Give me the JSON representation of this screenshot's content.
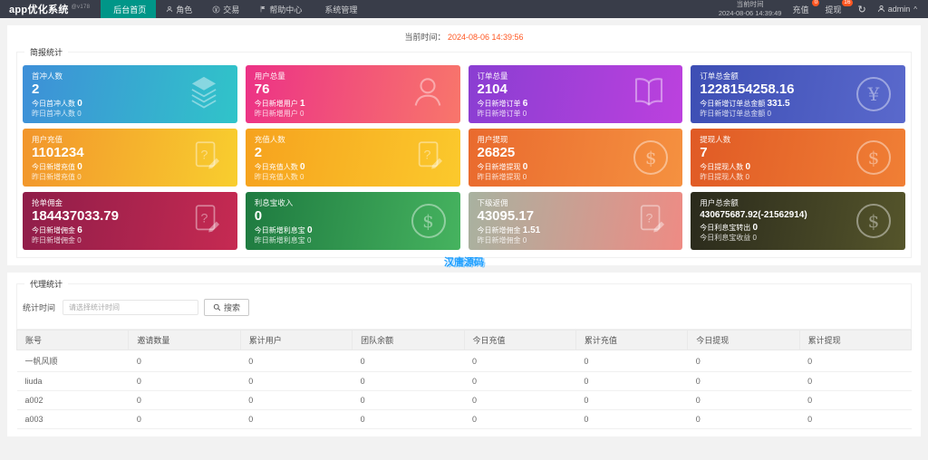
{
  "navbar": {
    "logo": "app优化系统",
    "logo_sub": "@v178",
    "menu": [
      {
        "label": "后台首页",
        "icon": "",
        "active": true
      },
      {
        "label": "角色",
        "icon": "nav-user",
        "active": false
      },
      {
        "label": "交易",
        "icon": "nav-yen",
        "active": false
      },
      {
        "label": "帮助中心",
        "icon": "nav-flag",
        "active": false
      },
      {
        "label": "系统管理",
        "icon": "",
        "active": false
      }
    ],
    "time_label": "当前时间",
    "time_value": "2024-08-06 14:39:49",
    "recharge_label": "充值",
    "recharge_badge": "0",
    "withdraw_label": "提现",
    "withdraw_badge": "16",
    "refresh_icon": "↻",
    "username": "admin",
    "caret": "^"
  },
  "overview": {
    "legend": "简报统计",
    "current_time_label": "当前时间：",
    "current_time_value": "2024-08-06 14:39:56",
    "watermark": "汉唐源码",
    "cards": [
      {
        "title": "首冲人数",
        "value": "2",
        "tl": "今日首冲人数",
        "tv": "0",
        "yl": "昨日首冲人数",
        "yv": "0",
        "icon": "layers",
        "gradient": "linear-gradient(100deg,#3E8FD8 0%,#30C4C9 100%)"
      },
      {
        "title": "用户总量",
        "value": "76",
        "tl": "今日新增用户",
        "tv": "1",
        "yl": "昨日新增用户",
        "yv": "0",
        "icon": "user",
        "gradient": "linear-gradient(100deg,#EC3286 0%,#F8766B 100%)"
      },
      {
        "title": "订单总量",
        "value": "2104",
        "tl": "今日新增订单",
        "tv": "6",
        "yl": "昨日新增订单",
        "yv": "0",
        "icon": "book",
        "gradient": "linear-gradient(100deg,#8A3ED2 0%,#BC41DE 100%)"
      },
      {
        "title": "订单总金额",
        "value": "1228154258.16",
        "tl": "今日新增订单总金额",
        "tv": "331.5",
        "yl": "昨日新增订单总金额",
        "yv": "0",
        "icon": "yen",
        "gradient": "linear-gradient(100deg,#3D4EB4 0%,#5A69CC 100%)"
      },
      {
        "title": "用户充值",
        "value": "1101234",
        "tl": "今日新增充值",
        "tv": "0",
        "yl": "昨日新增充值",
        "yv": "0",
        "icon": "doc-question",
        "gradient": "linear-gradient(100deg,#F2952C 0%,#F8CE2E 100%)"
      },
      {
        "title": "充值人数",
        "value": "2",
        "tl": "今日充值人数",
        "tv": "0",
        "yl": "昨日充值人数",
        "yv": "0",
        "icon": "doc-question",
        "gradient": "linear-gradient(100deg,#F6A21E 0%,#FBC92C 100%)"
      },
      {
        "title": "用户提现",
        "value": "26825",
        "tl": "今日新增提现",
        "tv": "0",
        "yl": "昨日新增提现",
        "yv": "0",
        "icon": "dollar",
        "gradient": "linear-gradient(100deg,#E96A2E 0%,#F59140 100%)"
      },
      {
        "title": "提现人数",
        "value": "7",
        "tl": "今日提现人数",
        "tv": "0",
        "yl": "昨日提现人数",
        "yv": "0",
        "icon": "dollar",
        "gradient": "linear-gradient(100deg,#E05A25 0%,#F07F35 100%)"
      },
      {
        "title": "抢单佣金",
        "value": "184437033.79",
        "tl": "今日新增佣金",
        "tv": "6",
        "yl": "昨日新增佣金",
        "yv": "0",
        "icon": "doc-question",
        "gradient": "linear-gradient(100deg,#8F1D49 0%,#C62A52 100%)"
      },
      {
        "title": "利息宝收入",
        "value": "0",
        "tl": "今日新增利息宝",
        "tv": "0",
        "yl": "昨日新增利息宝",
        "yv": "0",
        "icon": "dollar",
        "gradient": "linear-gradient(100deg,#1E7A40 0%,#46B35F 100%)"
      },
      {
        "title": "下级返佣",
        "value": "43095.17",
        "tl": "今日新增佣金",
        "tv": "1.51",
        "yl": "昨日新增佣金",
        "yv": "0",
        "icon": "doc-question",
        "gradient": "linear-gradient(100deg,#A8B2A0 0%,#EE8B84 100%)"
      },
      {
        "title": "用户总余额",
        "value": "430675687.92(-21562914)",
        "tl": "今日利息宝转出",
        "tv": "0",
        "yl": "今日利息宝收益",
        "yv": "0",
        "icon": "dollar",
        "gradient": "linear-gradient(100deg,#2A2A1C 0%,#55552B 100%)"
      }
    ]
  },
  "agent": {
    "legend": "代理统计",
    "filter_label": "统计时间",
    "filter_placeholder": "请选择统计时间",
    "search_label": "搜索",
    "table": {
      "headers": [
        "账号",
        "邀请数量",
        "累计用户",
        "团队余额",
        "今日充值",
        "累计充值",
        "今日提现",
        "累计提现"
      ],
      "rows": [
        [
          "一帆风顺",
          "0",
          "0",
          "0",
          "0",
          "0",
          "0",
          "0"
        ],
        [
          "liuda",
          "0",
          "0",
          "0",
          "0",
          "0",
          "0",
          "0"
        ],
        [
          "a002",
          "0",
          "0",
          "0",
          "0",
          "0",
          "0",
          "0"
        ],
        [
          "a003",
          "0",
          "0",
          "0",
          "0",
          "0",
          "0",
          "0"
        ]
      ]
    }
  }
}
